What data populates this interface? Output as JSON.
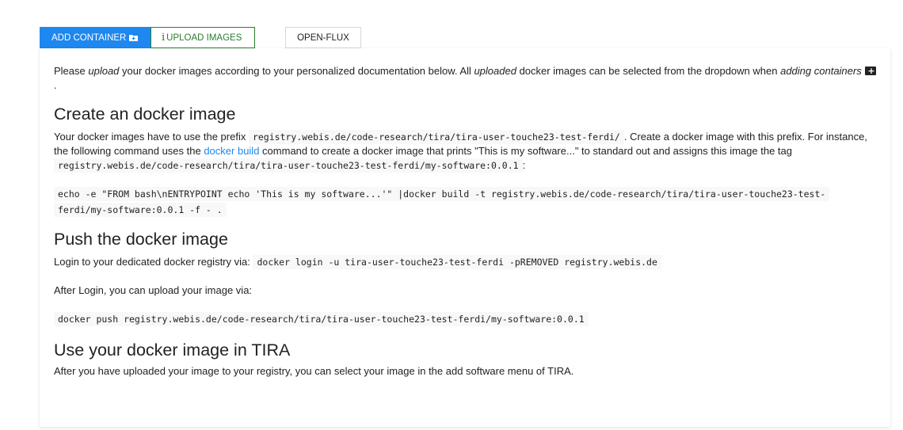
{
  "tabs": {
    "add_container": "ADD CONTAINER",
    "upload_images": "UPLOAD IMAGES",
    "open_flux": "OPEN-FLUX"
  },
  "intro": {
    "t1": "Please ",
    "t1_em": "upload",
    "t2": " your docker images according to your personalized documentation below. All ",
    "t2_em": "uploaded",
    "t3": " docker images can be selected from the dropdown when ",
    "t3_em": "adding containers",
    "t4": "."
  },
  "section_create": {
    "heading": "Create an docker image",
    "p1": "Your docker images have to use the prefix ",
    "prefix_code": "registry.webis.de/code-research/tira/tira-user-touche23-test-ferdi/",
    "p2": ". Create a docker image with this prefix. For instance, the following command uses the ",
    "link_text": "docker build",
    "p3": " command to create a docker image that prints \"This is my software...\" to standard out and assigns this image the tag ",
    "tag_code": "registry.webis.de/code-research/tira/tira-user-touche23-test-ferdi/my-software:0.0.1",
    "p4": ":",
    "command_line1": "echo -e \"FROM bash\\nENTRYPOINT echo 'This is my software...'\" |docker build -t registry.webis.de/code-research/tira/tira-user-touche23-test-",
    "command_line2": "ferdi/my-software:0.0.1 -f - ."
  },
  "section_push": {
    "heading": "Push the docker image",
    "login_label": "Login to your dedicated docker registry via: ",
    "login_code": "docker login -u tira-user-touche23-test-ferdi -pREMOVED registry.webis.de",
    "after_login": "After Login, you can upload your image via:",
    "push_code": "docker push registry.webis.de/code-research/tira/tira-user-touche23-test-ferdi/my-software:0.0.1"
  },
  "section_use": {
    "heading": "Use your docker image in TIRA",
    "text": "After you have uploaded your image to your registry, you can select your image in the add software menu of TIRA."
  },
  "icons": {
    "add_container_icon": "folder-plus-icon",
    "upload_icon": "info-icon",
    "inline_icon": "folder-plus-icon"
  },
  "colors": {
    "primary": "#1e87f0",
    "success": "#2a7d2e"
  }
}
